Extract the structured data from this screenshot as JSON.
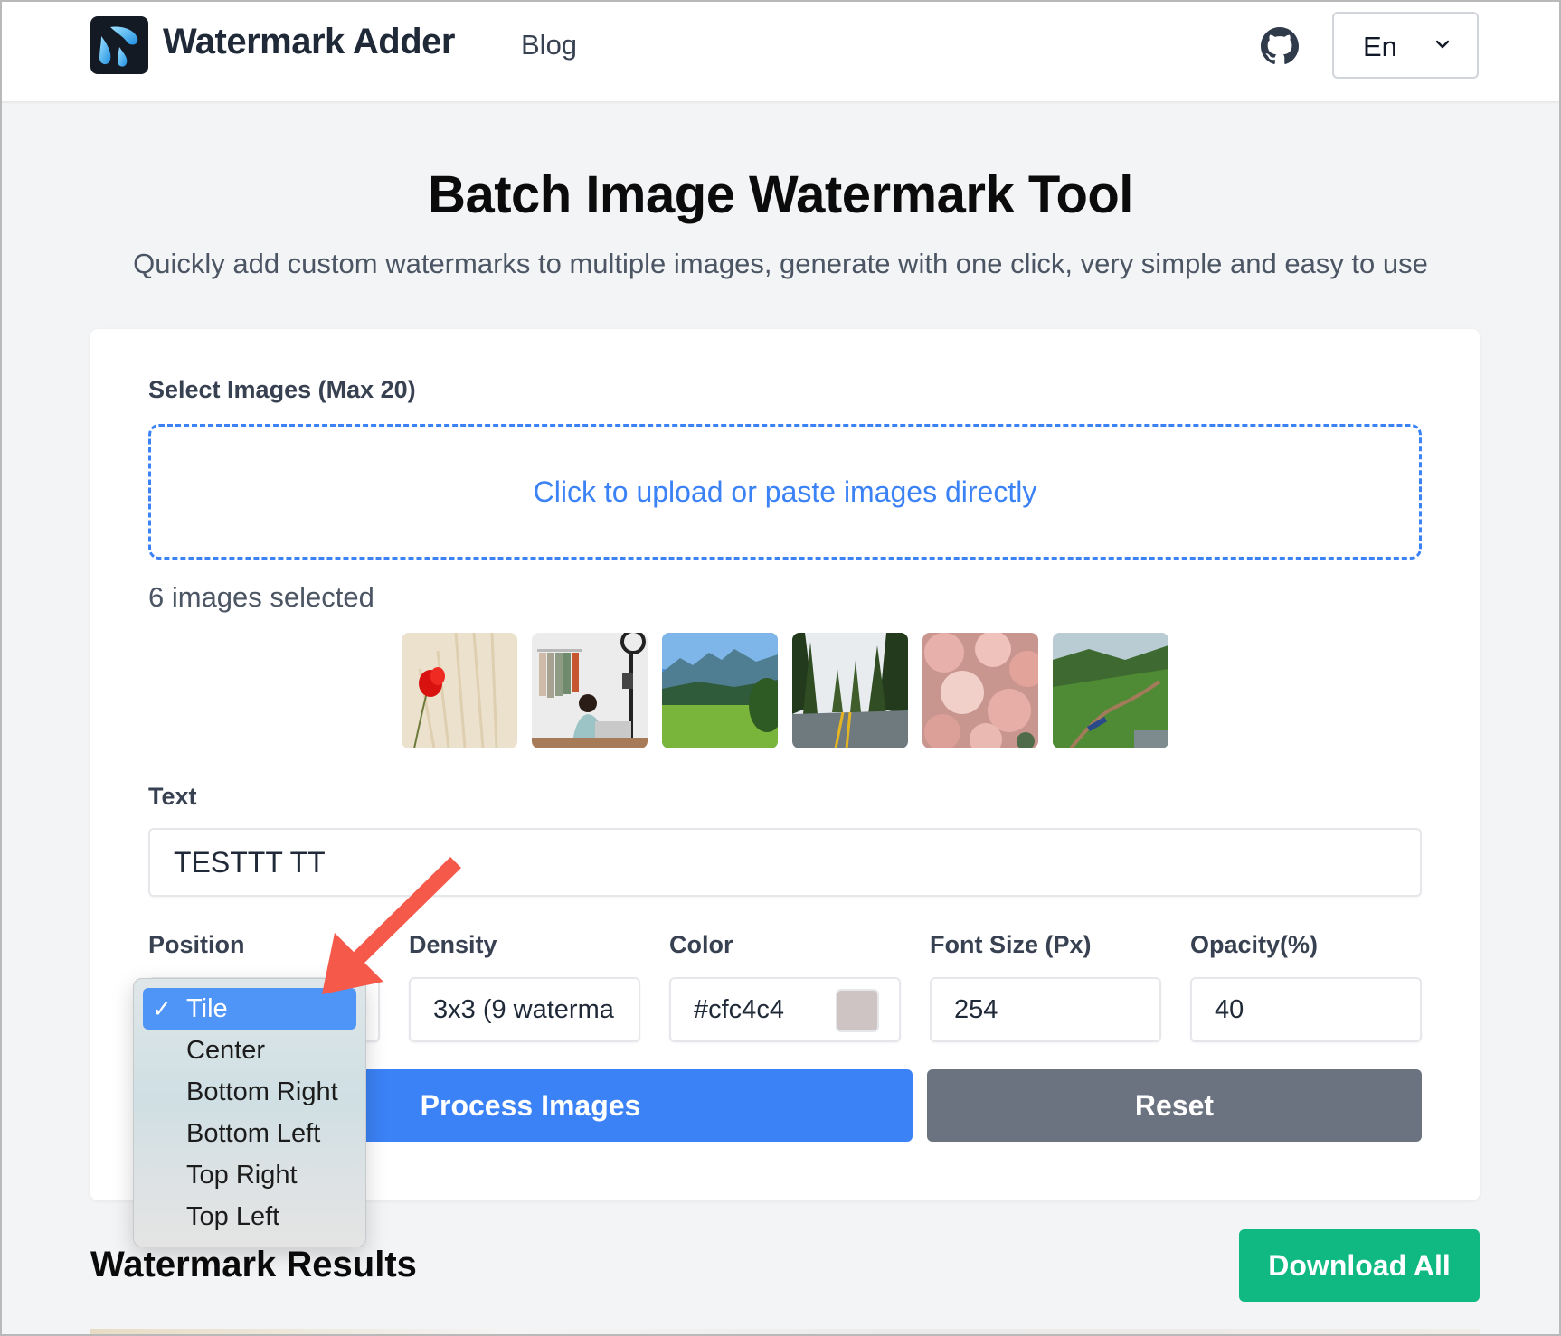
{
  "header": {
    "app_name": "Watermark Adder",
    "nav": {
      "blog": "Blog"
    },
    "github_icon": "github-icon",
    "language": {
      "selected": "En"
    }
  },
  "hero": {
    "title": "Batch Image Watermark Tool",
    "subtitle": "Quickly add custom watermarks to multiple images, generate with one click, very simple and easy to use"
  },
  "form": {
    "select_images_label": "Select Images (Max 20)",
    "upload_prompt": "Click to upload or paste images directly",
    "selected_count_text": "6 images selected",
    "thumbnails": [
      {
        "subject": "red poppy in wheat field"
      },
      {
        "subject": "woman at laptop with clothing rack"
      },
      {
        "subject": "green meadow with mountains"
      },
      {
        "subject": "road through pine forest"
      },
      {
        "subject": "pink roses"
      },
      {
        "subject": "train through green valley"
      }
    ],
    "text_label": "Text",
    "text_value": "TESTTT TT",
    "position_label": "Position",
    "density_label": "Density",
    "density_value": "3x3 (9 waterma",
    "color_label": "Color",
    "color_value": "#cfc4c4",
    "color_swatch": "#cfc4c4",
    "font_size_label": "Font Size (Px)",
    "font_size_value": "254",
    "opacity_label": "Opacity(%)",
    "opacity_value": "40",
    "process_button": "Process Images",
    "reset_button": "Reset"
  },
  "position_dropdown": {
    "selected": "Tile",
    "check_glyph": "✓",
    "options": [
      "Tile",
      "Center",
      "Bottom Right",
      "Bottom Left",
      "Top Right",
      "Top Left"
    ]
  },
  "results": {
    "title": "Watermark Results",
    "download_all_button": "Download All"
  },
  "colors": {
    "primary": "#3b82f6",
    "secondary": "#6b7280",
    "success": "#10b981",
    "annotation_arrow": "#f4594a"
  }
}
